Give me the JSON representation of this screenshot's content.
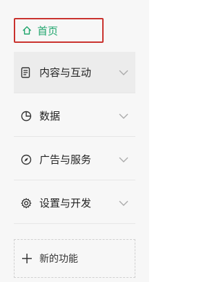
{
  "sidebar": {
    "home": {
      "label": "首页",
      "icon": "home-icon",
      "color": "#1fa56c"
    },
    "items": [
      {
        "label": "内容与互动",
        "icon": "document-icon"
      },
      {
        "label": "数据",
        "icon": "pie-chart-icon"
      },
      {
        "label": "广告与服务",
        "icon": "compass-icon"
      },
      {
        "label": "设置与开发",
        "icon": "gear-icon"
      }
    ],
    "new_feature": {
      "label": "新的功能",
      "icon": "plus-icon"
    },
    "highlight_color": "#c9302c"
  }
}
